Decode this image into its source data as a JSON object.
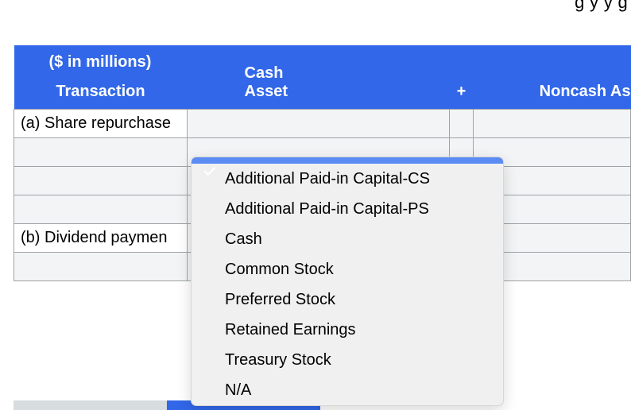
{
  "top_partial_text": "g  y  y        g",
  "header": {
    "currency_note": "($ in millions)",
    "col_transaction": "Transaction",
    "col_cash_line1": "Cash",
    "col_cash_line2": "Asset",
    "col_plus": "+",
    "col_noncash": "Noncash As"
  },
  "rows": {
    "r1_label": "(a) Share repurchase",
    "r5_label": "(b) Dividend paymen"
  },
  "dropdown": {
    "options": [
      "",
      "Additional Paid-in Capital-CS",
      "Additional Paid-in Capital-PS",
      "Cash",
      "Common Stock",
      "Preferred Stock",
      "Retained Earnings",
      "Treasury Stock",
      "N/A"
    ]
  },
  "colors": {
    "header_blue": "#3167e8",
    "row_gray": "#f3f4f5",
    "dropdown_highlight": "#5a8cf4"
  }
}
